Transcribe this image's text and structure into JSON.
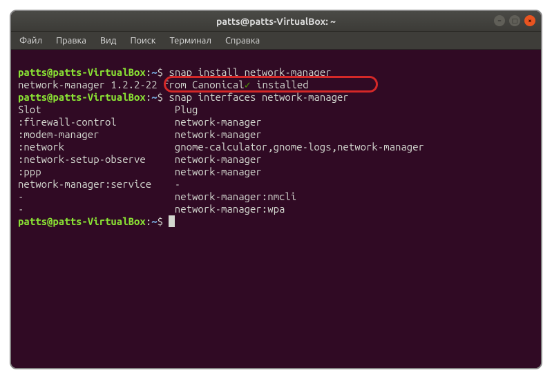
{
  "window": {
    "title": "patts@patts-VirtualBox: ~"
  },
  "menubar": {
    "items": [
      "Файл",
      "Правка",
      "Вид",
      "Поиск",
      "Терминал",
      "Справка"
    ]
  },
  "prompt": {
    "user": "patts@patts-VirtualBox",
    "sep": ":",
    "path": "~",
    "dollar": "$"
  },
  "lines": {
    "cmd1": " snap install network-manager",
    "out1a": "network-manager 1.2.2-22 from Canonical",
    "out1check": "✓",
    "out1b": " installed",
    "cmd2": " snap interfaces network-manager",
    "header": "Slot                       Plug",
    "row1": ":firewall-control          network-manager",
    "row2": ":modem-manager             network-manager",
    "row3": ":network                   gnome-calculator,gnome-logs,network-manager",
    "row4": ":network-setup-observe     network-manager",
    "row5": ":ppp                       network-manager",
    "row6": "network-manager:service    -",
    "row7": "-                          network-manager:nmcli",
    "row8": "-                          network-manager:wpa"
  }
}
